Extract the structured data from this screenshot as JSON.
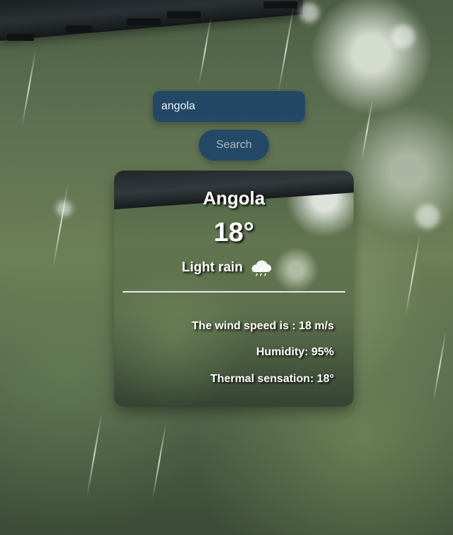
{
  "search": {
    "value": "angola",
    "button_label": "Search"
  },
  "weather": {
    "city": "Angola",
    "temperature": "18°",
    "condition": "Light rain",
    "condition_icon": "cloud-rain-icon",
    "wind": "The wind speed is : 18 m/s",
    "humidity": "Humidity: 95%",
    "thermal": "Thermal sensation: 18°"
  },
  "colors": {
    "control_bg": "#17406a",
    "text": "#ffffff",
    "button_text": "#aeb8c3"
  }
}
